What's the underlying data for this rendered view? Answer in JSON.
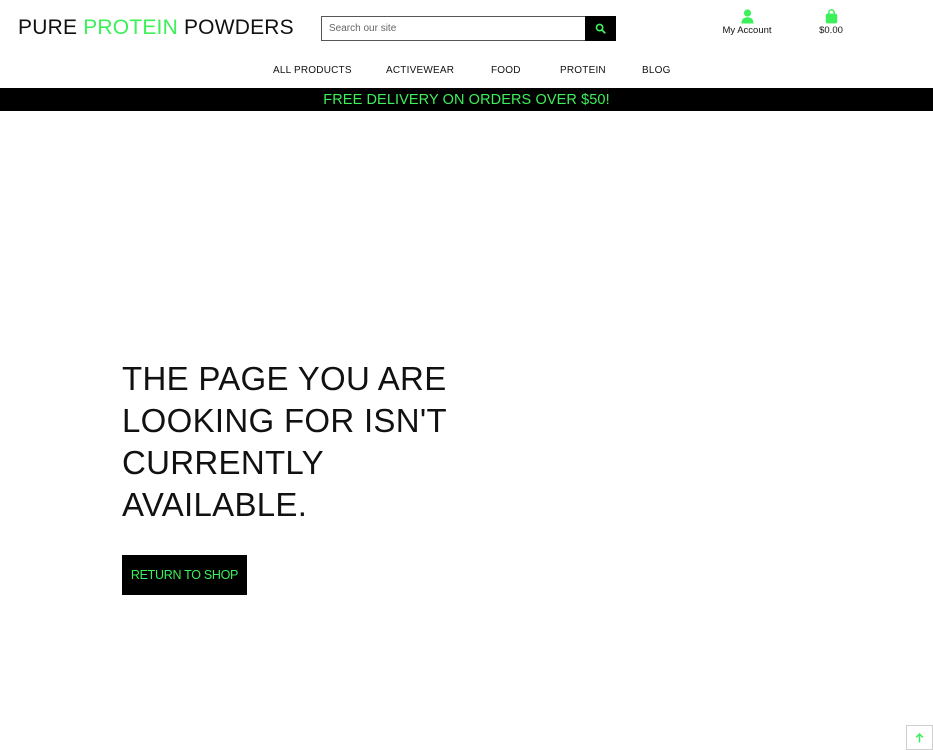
{
  "header": {
    "logo": {
      "part1": "PURE ",
      "part2": "PROTEIN",
      "part3": " POWDERS"
    },
    "search": {
      "placeholder": "Search our site",
      "button_icon": "search-icon"
    },
    "account": {
      "label": "My Account",
      "icon": "user-icon"
    },
    "cart": {
      "total": "$0.00",
      "icon": "shopping-bag-icon"
    }
  },
  "nav": {
    "items": [
      {
        "label": "ALL PRODUCTS"
      },
      {
        "label": "ACTIVEWEAR"
      },
      {
        "label": "FOOD"
      },
      {
        "label": "PROTEIN"
      },
      {
        "label": "BLOG"
      }
    ]
  },
  "promo": {
    "text": "FREE DELIVERY ON ORDERS OVER $50!"
  },
  "main": {
    "headline": "THE PAGE YOU ARE LOOKING FOR ISN'T CURRENTLY AVAILABLE.",
    "cta_label": "RETURN TO SHOP"
  },
  "back_to_top": {
    "icon": "arrow-up-icon"
  },
  "colors": {
    "accent": "#3cf05a",
    "dark": "#000000",
    "text": "#111111"
  }
}
